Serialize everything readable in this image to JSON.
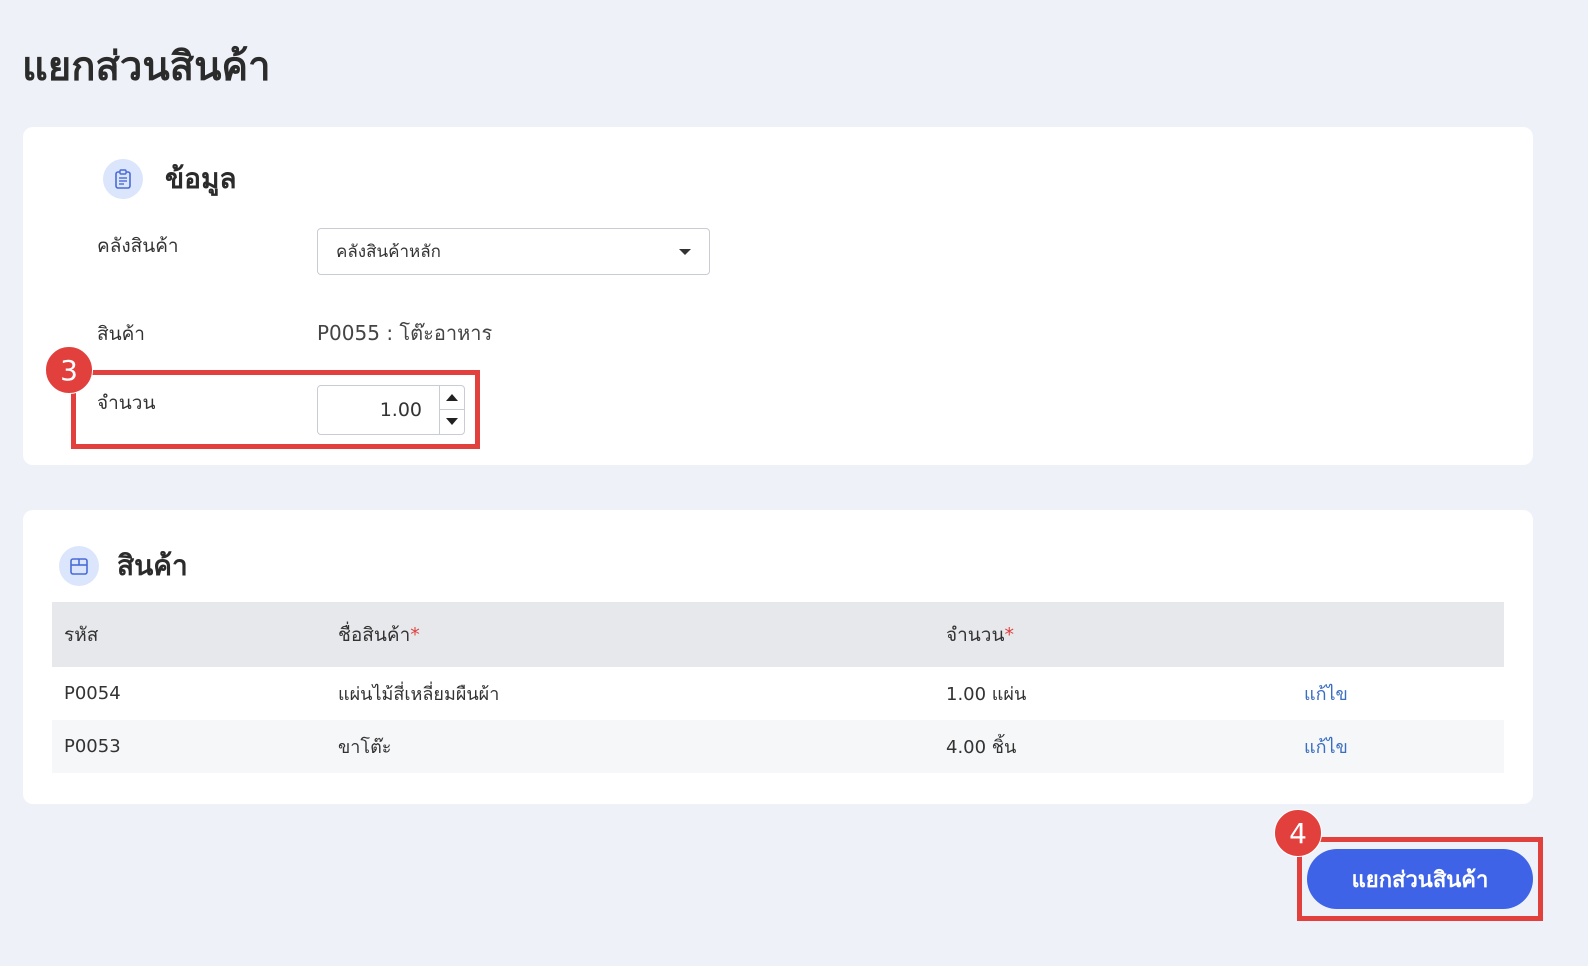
{
  "page": {
    "title": "แยกส่วนสินค้า"
  },
  "info_section": {
    "title": "ข้อมูล",
    "icon": "clipboard-icon",
    "warehouse_label": "คลังสินค้า",
    "warehouse_value": "คลังสินค้าหลัก",
    "product_label": "สินค้า",
    "product_value": "P0055 : โต๊ะอาหาร",
    "quantity_label": "จำนวน",
    "quantity_value": "1.00"
  },
  "products_section": {
    "title": "สินค้า",
    "icon": "box-icon",
    "columns": [
      "รหัส",
      "ชื่อสินค้า",
      "จำนวน",
      ""
    ],
    "required_mark": "*",
    "rows": [
      {
        "code": "P0054",
        "name": "แผ่นไม้สี่เหลี่ยมผืนผ้า",
        "qty": "1.00 แผ่น",
        "action": "แก้ไข"
      },
      {
        "code": "P0053",
        "name": "ขาโต๊ะ",
        "qty": "4.00 ชิ้น",
        "action": "แก้ไข"
      }
    ]
  },
  "actions": {
    "split_label": "แยกส่วนสินค้า"
  },
  "annotations": {
    "step3": "3",
    "step4": "4",
    "color": "#e2403c"
  },
  "colors": {
    "accent": "#3e63e6",
    "link": "#3a6ec0"
  }
}
